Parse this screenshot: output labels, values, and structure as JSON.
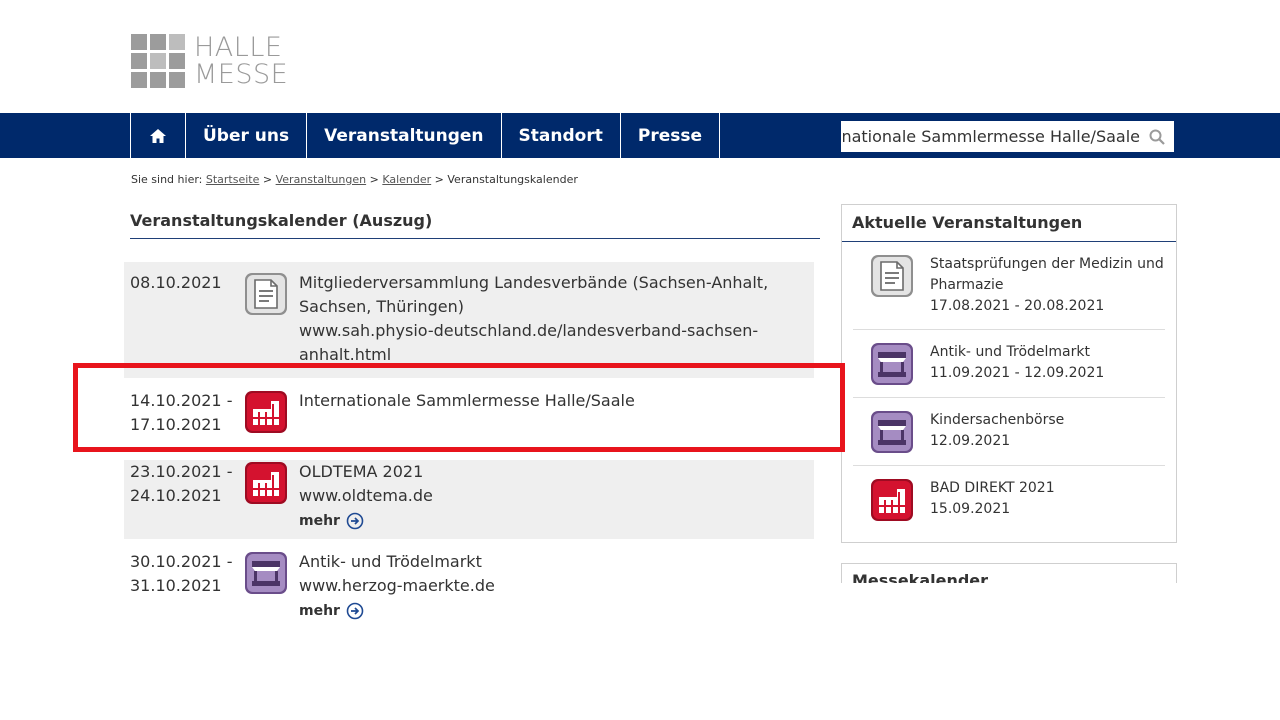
{
  "logo": {
    "line1": "HALLE",
    "line2": "MESSE"
  },
  "nav": {
    "items": [
      "Über uns",
      "Veranstaltungen",
      "Standort",
      "Presse"
    ]
  },
  "search": {
    "value": "Internationale Sammlermesse Halle/Saale"
  },
  "breadcrumb": {
    "prefix": "Sie sind hier:",
    "links": [
      "Startseite",
      "Veranstaltungen",
      "Kalender"
    ],
    "current": "Veranstaltungskalender",
    "separator": ">"
  },
  "main": {
    "title": "Veranstaltungskalender (Auszug)"
  },
  "events": [
    {
      "date1": "08.10.2021",
      "date2": "",
      "title": "Mitgliederversammlung Landesverbände (Sachsen-Anhalt, Sachsen, Thüringen)",
      "link": "www.sah.physio-deutschland.de/landesverband-sachsen-anhalt.html",
      "icon": "document-icon"
    },
    {
      "date1": "14.10.2021 -",
      "date2": "17.10.2021",
      "title": "Internationale Sammlermesse Halle/Saale",
      "link": "",
      "icon": "exhibition-hall-icon"
    },
    {
      "date1": "23.10.2021 -",
      "date2": "24.10.2021",
      "title": "OLDTEMA 2021",
      "link": "www.oldtema.de",
      "more": "mehr",
      "icon": "exhibition-hall-icon"
    },
    {
      "date1": "30.10.2021 -",
      "date2": "31.10.2021",
      "title": "Antik- und Trödelmarkt",
      "link": "www.herzog-maerkte.de",
      "more": "mehr",
      "icon": "market-stall-icon"
    }
  ],
  "sidebar": {
    "title": "Aktuelle Veranstaltungen",
    "items": [
      {
        "title": "Staatsprüfungen der Medizin und Pharmazie",
        "dates": "17.08.2021 - 20.08.2021",
        "icon": "document-icon"
      },
      {
        "title": "Antik- und Trödelmarkt",
        "dates": "11.09.2021 - 12.09.2021",
        "icon": "market-stall-icon"
      },
      {
        "title": "Kindersachenbörse",
        "dates": "12.09.2021",
        "icon": "market-stall-icon"
      },
      {
        "title": "BAD DIREKT 2021",
        "dates": "15.09.2021",
        "icon": "exhibition-hall-icon"
      }
    ]
  },
  "sidebar2": {
    "title": "Messekalender"
  },
  "colors": {
    "nav_bg": "#00296b",
    "highlight": "#e8141c",
    "exhibition_red": "#c8102e",
    "market_purple": "#8a6aa8",
    "doc_gray": "#9a9a9a"
  }
}
